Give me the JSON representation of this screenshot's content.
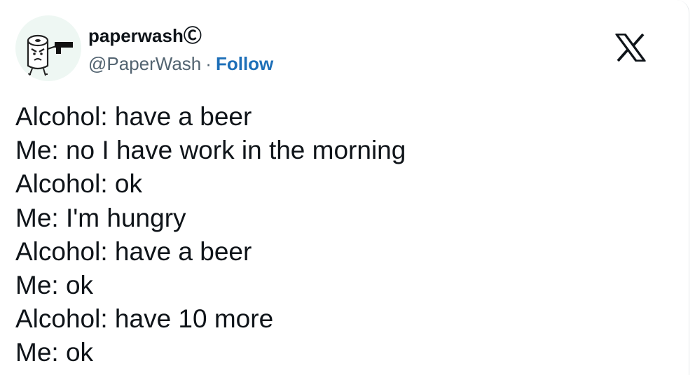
{
  "author": {
    "display_name": "paperwashⒸ",
    "handle": "@PaperWash",
    "separator": "·",
    "follow_label": "Follow",
    "avatar_icon": "toilet-paper-with-gun-icon"
  },
  "brand": {
    "logo_icon": "x-logo-icon",
    "logo_color": "#0f1419",
    "link_color": "#1d6fb8"
  },
  "tweet": {
    "lines": [
      "Alcohol: have a beer",
      "Me: no I have work in the morning",
      "Alcohol: ok",
      "Me: I'm hungry",
      "Alcohol: have a beer",
      "Me: ok",
      "Alcohol: have 10 more",
      "Me: ok"
    ]
  }
}
